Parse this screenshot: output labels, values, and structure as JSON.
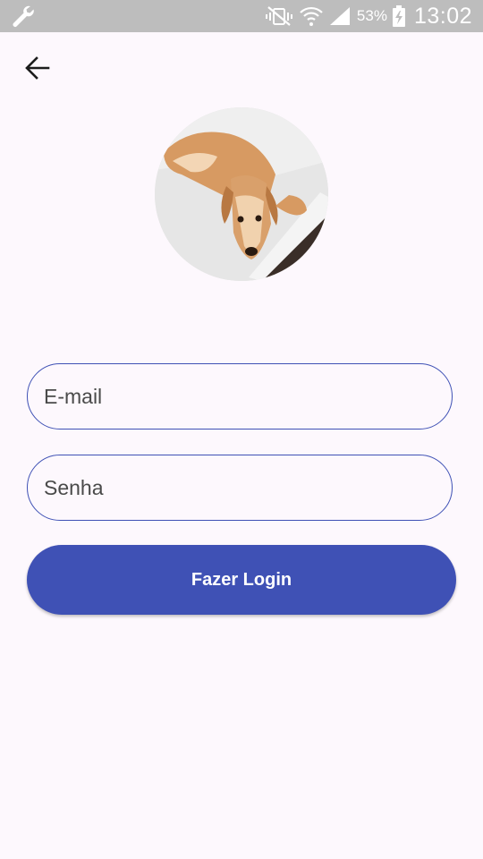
{
  "status_bar": {
    "battery_percent": "53%",
    "time": "13:02",
    "icons": [
      "wrench-icon",
      "vibrate-mute-icon",
      "wifi-icon",
      "signal-icon",
      "battery-charging-icon"
    ]
  },
  "header": {
    "back_icon": "arrow-back-icon"
  },
  "profile": {
    "avatar_description_icon": "dog-photo"
  },
  "form": {
    "email_placeholder": "E-mail",
    "password_placeholder": "Senha",
    "login_label": "Fazer Login"
  },
  "colors": {
    "primary": "#3f51b5",
    "background": "#fdf8fd",
    "status_bar": "#bdbdbd"
  }
}
